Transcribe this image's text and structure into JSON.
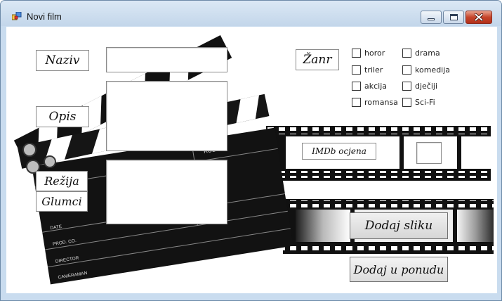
{
  "window": {
    "title": "Novi film",
    "icon": "app-window-icon",
    "controls": {
      "minimize": "minimize-icon",
      "maximize": "maximize-icon",
      "close": "close-icon"
    }
  },
  "form": {
    "naziv_label": "Naziv",
    "opis_label": "Opis",
    "rezija_label": "Režija",
    "glumci_label": "Glumci",
    "zanr_label": "Žanr",
    "imdb_label": "IMDb ocjena",
    "naziv_value": "",
    "opis_value": "",
    "glumci_value": "",
    "imdb_value": ""
  },
  "genres": [
    {
      "label": "horor",
      "checked": false
    },
    {
      "label": "triler",
      "checked": false
    },
    {
      "label": "akcija",
      "checked": false
    },
    {
      "label": "romansa",
      "checked": false
    },
    {
      "label": "drama",
      "checked": false
    },
    {
      "label": "komedija",
      "checked": false
    },
    {
      "label": "dječiji",
      "checked": false
    },
    {
      "label": "Sci-Fi",
      "checked": false
    }
  ],
  "buttons": {
    "add_image": "Dodaj sliku",
    "add_offer": "Dodaj u ponudu"
  },
  "clapperboard": {
    "roll": "ROLL",
    "date": "DATE",
    "prod": "PROD. CO.",
    "director": "DIRECTOR",
    "camera": "CAMERAMAN"
  }
}
